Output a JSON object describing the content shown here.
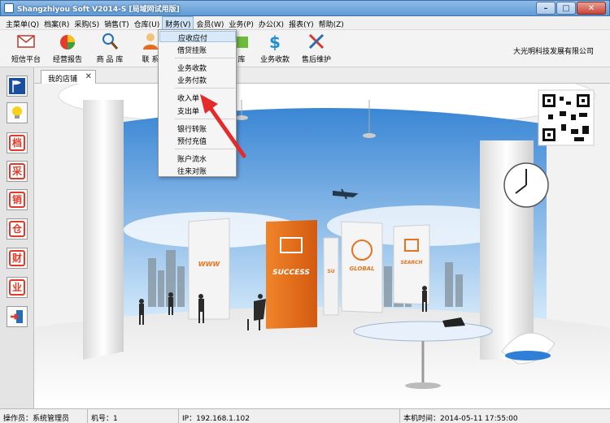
{
  "window": {
    "title": "Shangzhiyou Soft V2014-S [局域网试用版]"
  },
  "menubar": {
    "items": [
      "主菜单(Q)",
      "档案(R)",
      "采购(S)",
      "销售(T)",
      "仓库(U)",
      "财务(V)",
      "会员(W)",
      "业务(P)",
      "办公(X)",
      "报表(Y)",
      "帮助(Z)"
    ]
  },
  "toolbar": {
    "buttons": [
      "短信平台",
      "经营报告",
      "商 品 库",
      "联 系",
      "库",
      "业务收款",
      "售后维护"
    ],
    "company": "大光明科技发展有限公司"
  },
  "finance_menu": {
    "items": [
      "应收应付",
      "借贷挂账",
      "业务收款",
      "业务付款",
      "收入单",
      "支出单",
      "银行转账",
      "预付充值",
      "账户流水",
      "往来对账"
    ]
  },
  "sidebar": {
    "buttons": [
      "档",
      "采",
      "销",
      "仓",
      "财",
      "业"
    ]
  },
  "tabs": {
    "active": "我的店铺"
  },
  "scene": {
    "panels": [
      "WWW",
      "SUCCESS",
      "SU",
      "GLOBAL",
      "SEARCH"
    ]
  },
  "statusbar": {
    "operator": "操作员：系统管理员",
    "machine": "机号：1",
    "ip": "IP：192.168.1.102",
    "time": "本机时间：2014-05-11 17:55:00"
  },
  "colors": {
    "accent": "#e8731e",
    "menu_highlight": "#d9e9f8",
    "sidebar_red": "#e23a2a"
  }
}
